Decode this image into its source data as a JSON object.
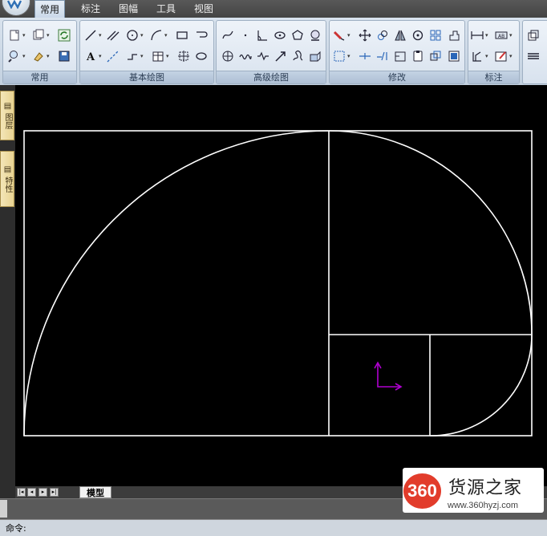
{
  "tabs": [
    "常用",
    "标注",
    "图幅",
    "工具",
    "视图"
  ],
  "active_tab": "常用",
  "panels": [
    "常用",
    "基本绘图",
    "高级绘图",
    "修改",
    "标注"
  ],
  "palette": [
    "图层",
    "特性"
  ],
  "layout_tab": "模型",
  "command_label": "命令:",
  "watermark": {
    "badge": "360",
    "name": "货源之家",
    "url": "www.360hyzj.com"
  },
  "colors": {
    "drawing_lines": "#ffffff",
    "ucs_icon": "#b000d0",
    "canvas_bg": "#000000",
    "watermark_red": "#e23c2b"
  },
  "icons": {
    "common": [
      "new-icon",
      "open-icon",
      "refresh-icon",
      "zoom-icon",
      "pan-icon",
      "save-icon"
    ],
    "draw": [
      "line-icon",
      "parallel-line-icon",
      "circle-icon",
      "arc-icon",
      "rectangle-icon",
      "spline-loop-icon",
      "text-icon",
      "construction-line-icon",
      "polyline-icon",
      "table-icon",
      "point-icon",
      "ellipse-arc-icon"
    ],
    "advanced": [
      "spline-icon",
      "point-icon",
      "dimension-icon",
      "ellipse-icon",
      "polygon-icon",
      "hatch-icon",
      "cloud-icon",
      "wave-icon",
      "zigzag-icon",
      "arrow-icon",
      "freehand-icon",
      "block-icon"
    ],
    "modify": [
      "erase-icon",
      "move-icon",
      "copy-icon",
      "mirror-icon",
      "rotate-icon",
      "array-icon",
      "stretch-icon",
      "scale-icon",
      "trim-icon",
      "extend-icon",
      "break-icon",
      "join-icon",
      "explode-icon",
      "properties-icon"
    ],
    "annotate": [
      "linear-dimension-icon",
      "text-style-icon",
      "leader-icon",
      "edit-icon"
    ]
  }
}
